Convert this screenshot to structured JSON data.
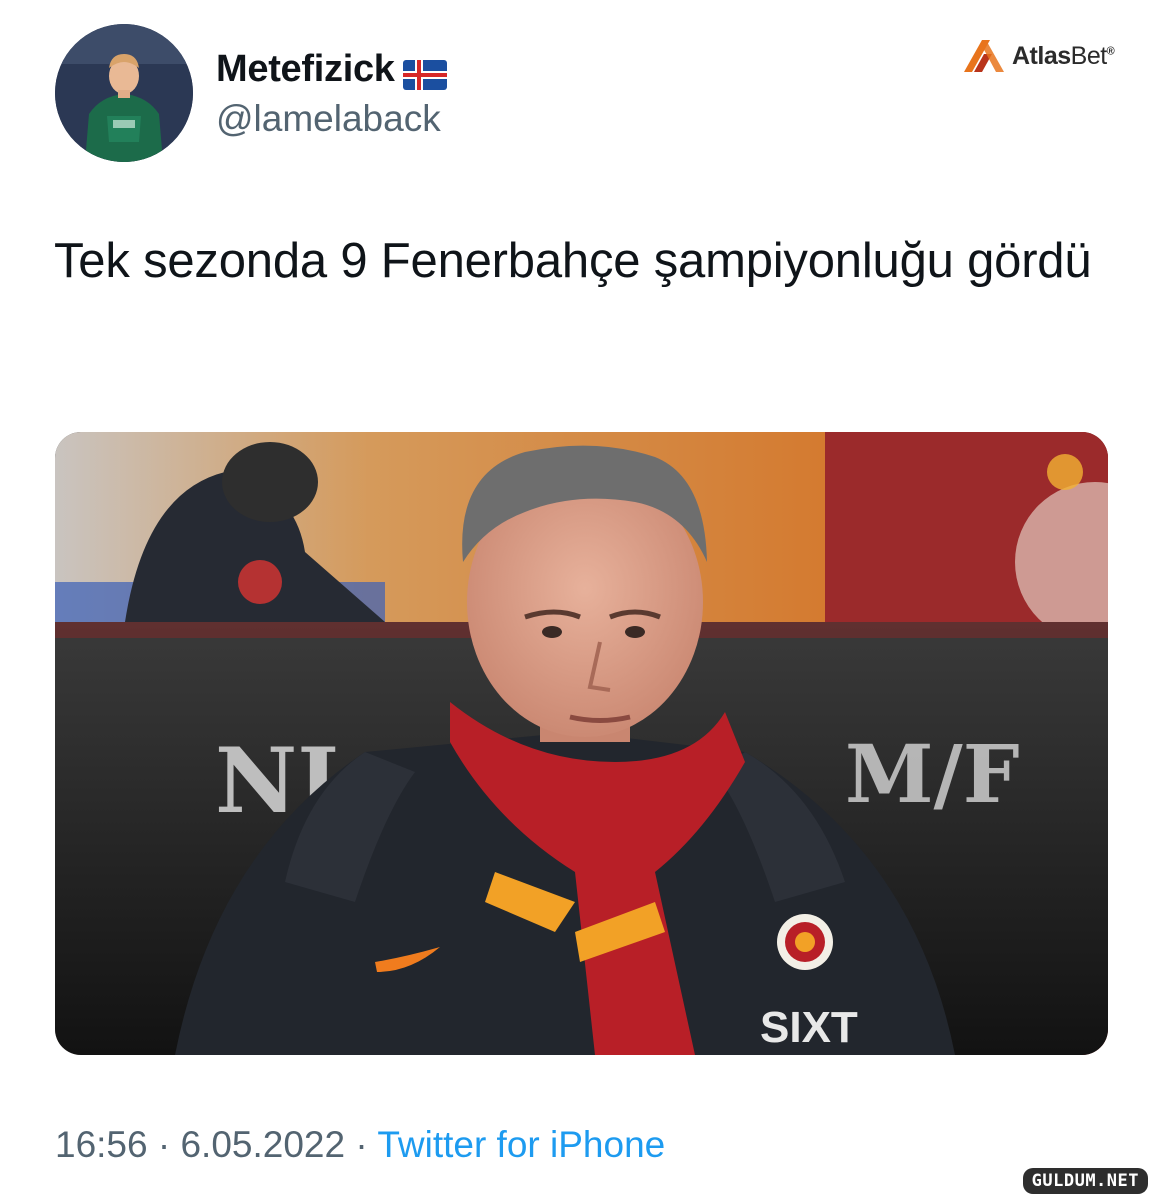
{
  "author": {
    "display_name": "Metefizick",
    "flag_icon": "iceland-flag-icon",
    "handle": "@lamelaback",
    "avatar_icon": "profile-photo-avatar"
  },
  "brand": {
    "icon": "atlasbet-logo-icon",
    "name_bold": "Atlas",
    "name_thin": "Bet",
    "reg": "®"
  },
  "tweet": {
    "text": "Tek sezonda 9 Fenerbahçe şampiyonluğu gördü",
    "image_icon": "coach-photo-image"
  },
  "meta": {
    "time": "16:56",
    "separator": " · ",
    "date": "6.05.2022",
    "source": "Twitter for iPhone"
  },
  "watermark": "GULDUM.NET",
  "colors": {
    "text": "#0f1419",
    "secondary": "#536471",
    "link": "#1d9bf0",
    "brand_orange": "#e8741c"
  }
}
